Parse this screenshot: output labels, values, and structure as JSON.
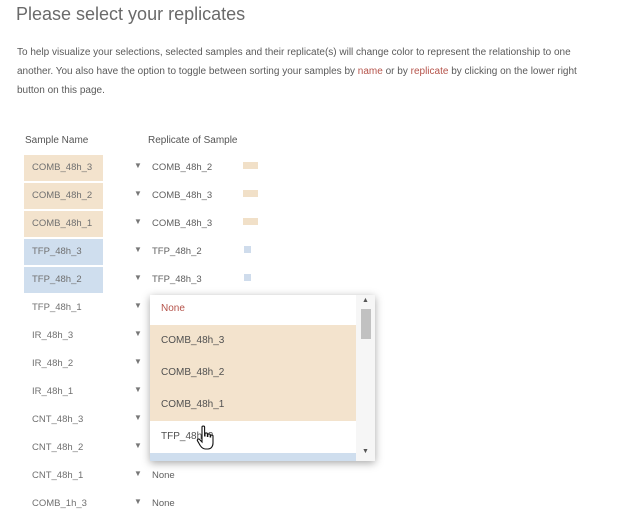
{
  "page": {
    "title": "Please select your replicates",
    "intro_part1": "To help visualize your selections, selected samples and their replicate(s) will change color to represent the relationship to one another. You also have the option to toggle between sorting your samples by ",
    "intro_name": "name",
    "intro_part2": " or by ",
    "intro_replicate": "replicate",
    "intro_part3": " by clicking on the lower right button on this page."
  },
  "columns": {
    "sample_name": "Sample Name",
    "replicate_of_sample": "Replicate of Sample"
  },
  "rows": [
    {
      "sample": "COMB_48h_3",
      "group": "comb",
      "replicate": "COMB_48h_2",
      "swatch": "comb"
    },
    {
      "sample": "COMB_48h_2",
      "group": "comb",
      "replicate": "COMB_48h_3",
      "swatch": "comb"
    },
    {
      "sample": "COMB_48h_1",
      "group": "comb",
      "replicate": "COMB_48h_3",
      "swatch": "comb"
    },
    {
      "sample": "TFP_48h_3",
      "group": "tfp",
      "replicate": "TFP_48h_2",
      "swatch": "tfp"
    },
    {
      "sample": "TFP_48h_2",
      "group": "tfp",
      "replicate": "TFP_48h_3",
      "swatch": "tfp"
    },
    {
      "sample": "TFP_48h_1",
      "group": "",
      "replicate": "",
      "swatch": ""
    },
    {
      "sample": "IR_48h_3",
      "group": "",
      "replicate": "",
      "swatch": ""
    },
    {
      "sample": "IR_48h_2",
      "group": "",
      "replicate": "",
      "swatch": ""
    },
    {
      "sample": "IR_48h_1",
      "group": "",
      "replicate": "",
      "swatch": ""
    },
    {
      "sample": "CNT_48h_3",
      "group": "",
      "replicate": "",
      "swatch": ""
    },
    {
      "sample": "CNT_48h_2",
      "group": "",
      "replicate": "",
      "swatch": ""
    },
    {
      "sample": "CNT_48h_1",
      "group": "",
      "replicate": "None",
      "swatch": ""
    },
    {
      "sample": "COMB_1h_3",
      "group": "",
      "replicate": "None",
      "swatch": ""
    }
  ],
  "dropdown": {
    "options": [
      {
        "label": "None",
        "kind": "none"
      },
      {
        "label": "COMB_48h_3",
        "kind": "comb"
      },
      {
        "label": "COMB_48h_2",
        "kind": "comb"
      },
      {
        "label": "COMB_48h_1",
        "kind": "comb"
      },
      {
        "label": "TFP_48h_3",
        "kind": "hover"
      },
      {
        "label": "",
        "kind": "tfp"
      }
    ]
  },
  "colors": {
    "comb": "#f3e3cd",
    "tfp": "#cfdeee",
    "accent_text": "#b5534a"
  },
  "icons": {
    "row_caret": "caret-down-icon",
    "cursor": "hand-pointer-icon"
  }
}
